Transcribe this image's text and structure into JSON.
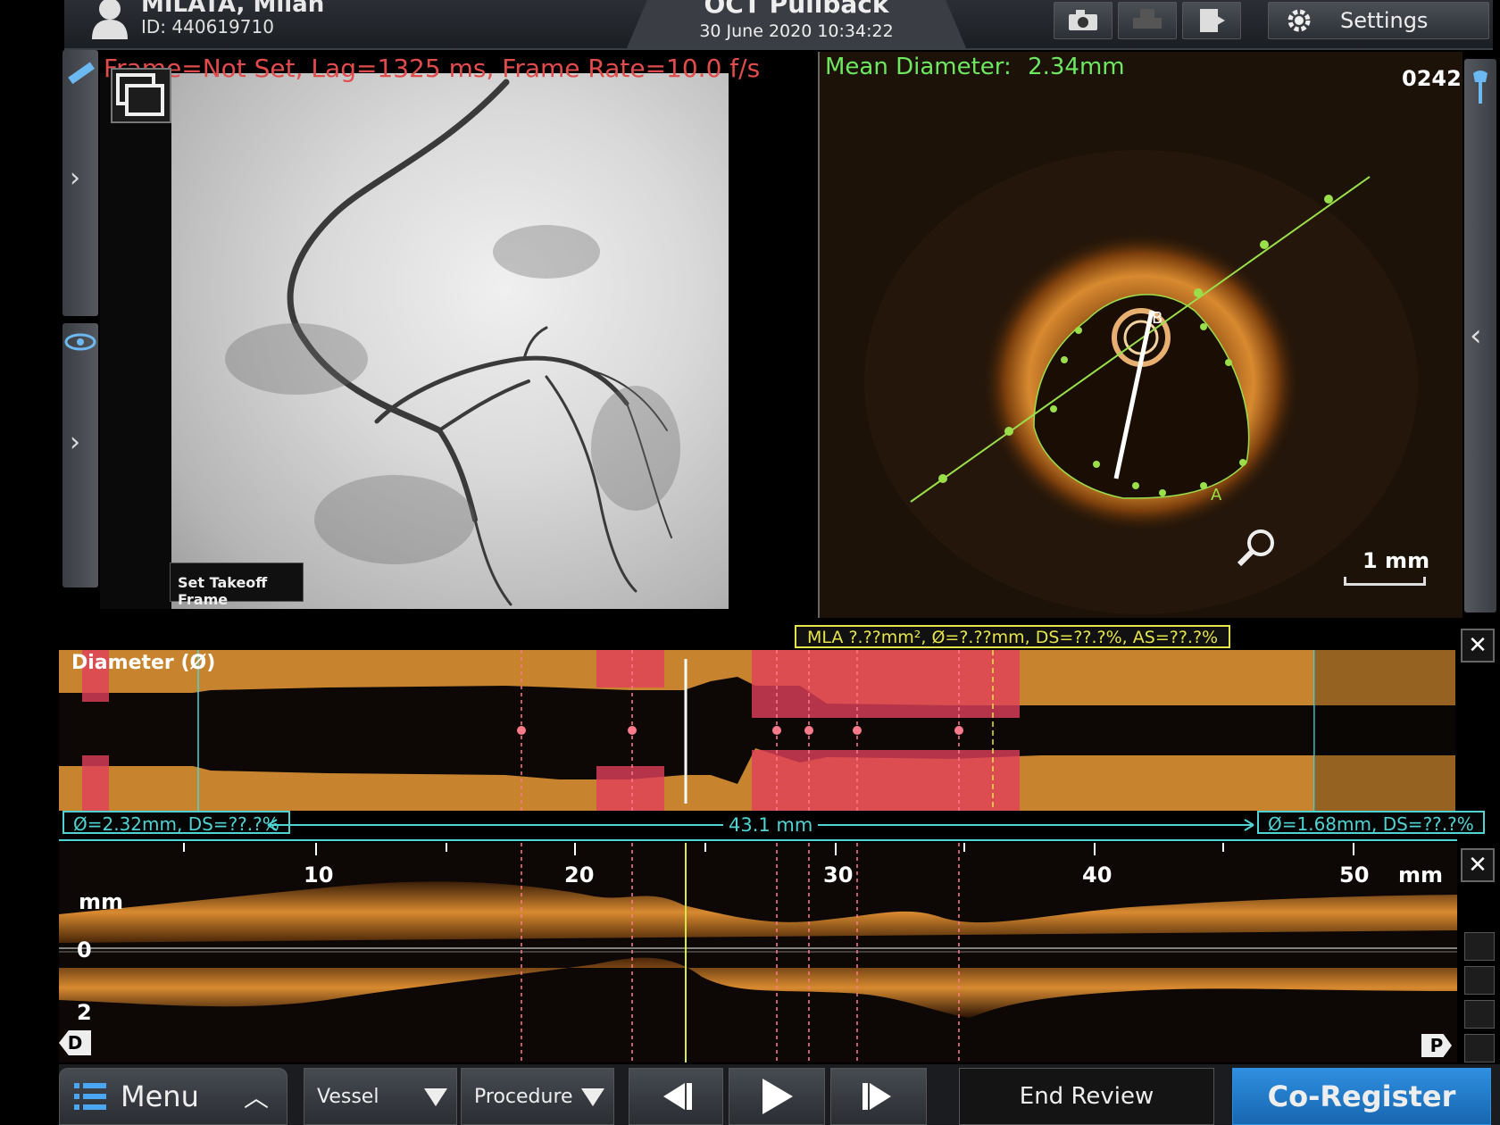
{
  "header": {
    "patient_name": "MILATA, Milan",
    "patient_id": "ID: 440619710",
    "exam_title": "OCT Pullback",
    "exam_date": "30 June 2020 10:34:22",
    "settings_label": "Settings",
    "icons": [
      "camera-icon",
      "print-icon",
      "export-icon",
      "gear-icon"
    ]
  },
  "angio": {
    "info_overlay": "Frame=Not Set, Lag=1325 ms, Frame Rate=10.0 f/s",
    "takeoff_button": "Set Takeoff Frame"
  },
  "oct_cross_section": {
    "mean_diameter_label": "Mean Diameter:",
    "mean_diameter_value": "2.34mm",
    "frame_number": "0242",
    "scale_label": "1 mm",
    "marker_a": "A",
    "marker_b": "B"
  },
  "diameter_plot": {
    "title": "Diameter (Ø)",
    "mla_label": "MLA ?.??mm², Ø=?.??mm, DS=??.?%, AS=??.?%",
    "left_ref": "Ø=2.32mm, DS=??.?%",
    "right_ref": "Ø=1.68mm, DS=??.?%",
    "length": "43.1 mm"
  },
  "longitudinal": {
    "axis_ticks": [
      "10",
      "20",
      "30",
      "40",
      "50"
    ],
    "axis_unit": "mm",
    "y_unit": "mm",
    "y_ticks": [
      "0",
      "2"
    ],
    "distal_label": "D",
    "proximal_label": "P"
  },
  "bottom_bar": {
    "menu_label": "Menu",
    "vessel_label": "Vessel",
    "procedure_label": "Procedure",
    "end_review_label": "End Review",
    "co_register_label": "Co-Register"
  },
  "colors": {
    "accent_green": "#6ee860",
    "measure_cyan": "#4fd3d3",
    "mla_yellow": "#e6e44a",
    "co_register_blue": "#1f7ad0",
    "tissue_orange": "#c9822a"
  }
}
